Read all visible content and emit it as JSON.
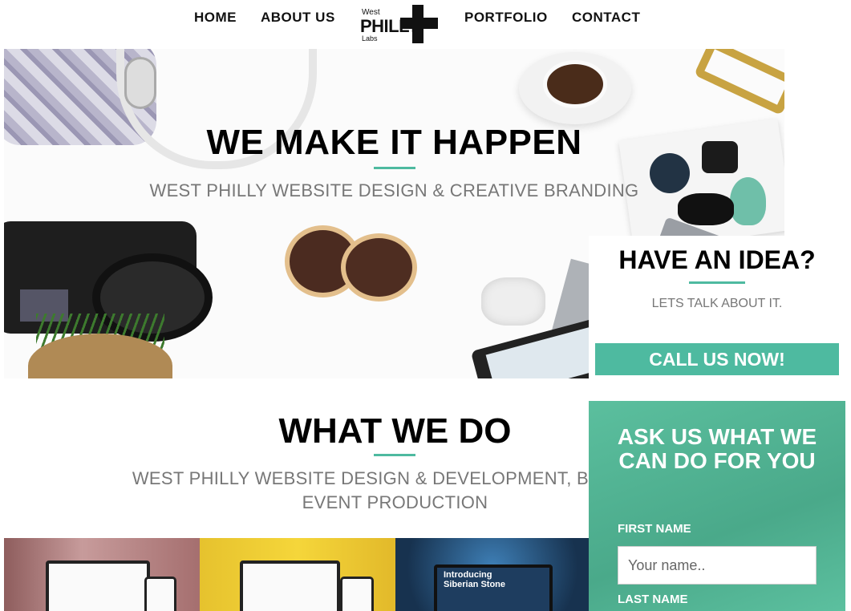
{
  "nav": {
    "items": [
      "HOME",
      "ABOUT US",
      "PORTFOLIO",
      "CONTACT"
    ],
    "logo": {
      "top": "West",
      "main": "PHILLY",
      "bottom": "Labs"
    }
  },
  "hero": {
    "title": "WE MAKE IT HAPPEN",
    "subtitle": "WEST PHILLY WEBSITE DESIGN & CREATIVE BRANDING"
  },
  "idea": {
    "title": "HAVE AN IDEA?",
    "subtitle": "LETS TALK ABOUT IT.",
    "button": "CALL US NOW!"
  },
  "what_we_do": {
    "title": "WHAT WE DO",
    "subtitle_line1": "WEST PHILLY WEBSITE DESIGN & DEVELOPMENT, BRANDIN",
    "subtitle_line2": "EVENT PRODUCTION"
  },
  "portfolio": {
    "tile3_text_line1": "Introducing",
    "tile3_text_line2": "Siberian Stone"
  },
  "ask": {
    "title_line1": "ASK US WHAT WE",
    "title_line2": "CAN DO FOR YOU",
    "first_name_label": "FIRST NAME",
    "first_name_placeholder": "Your name..",
    "last_name_label": "LAST NAME"
  },
  "colors": {
    "accent": "#4ebaa0",
    "form_bg": "#4fb291"
  }
}
